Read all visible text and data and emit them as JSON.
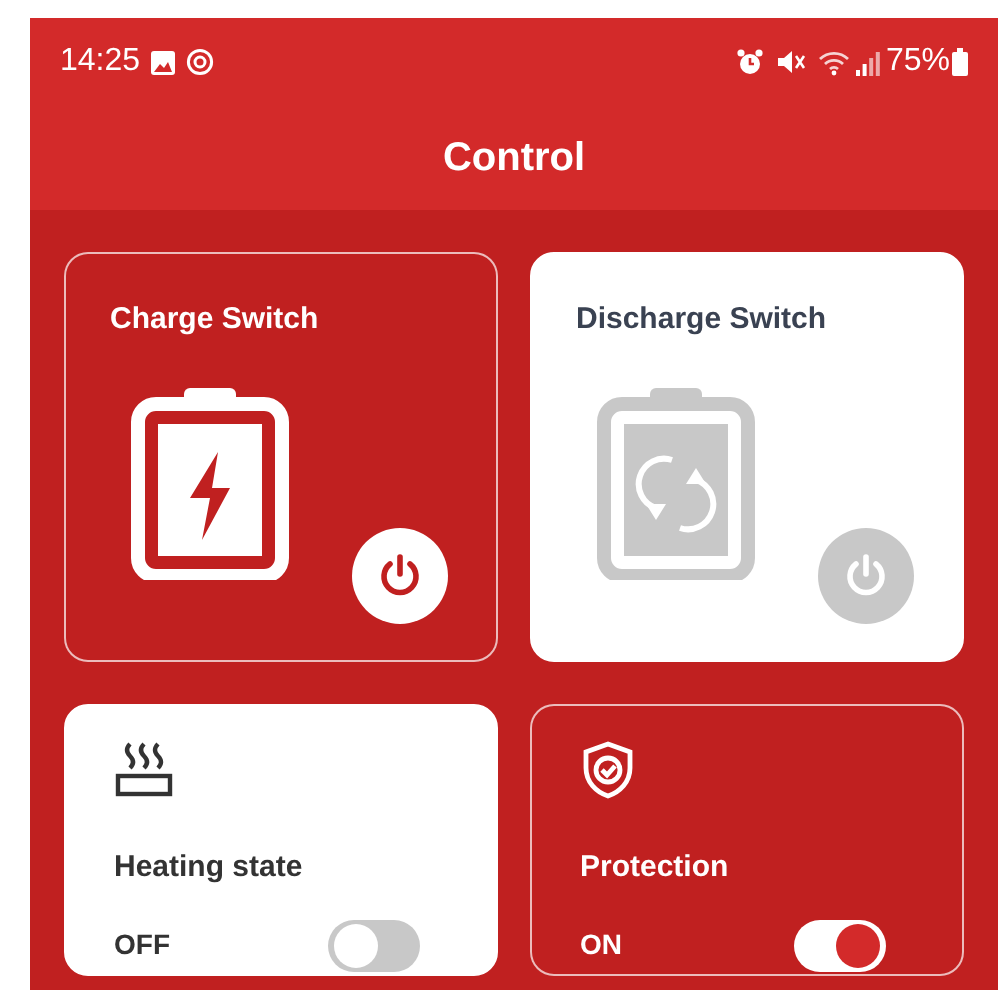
{
  "status_bar": {
    "time": "14:25",
    "battery": "75%"
  },
  "header": {
    "title": "Control"
  },
  "switches": [
    {
      "kind": "charge",
      "label": "Charge Switch",
      "on": true
    },
    {
      "kind": "discharge",
      "label": "Discharge Switch",
      "on": false
    }
  ],
  "toggles": [
    {
      "kind": "heating",
      "label": "Heating state",
      "state": "OFF",
      "on": false
    },
    {
      "kind": "protection",
      "label": "Protection",
      "state": "ON",
      "on": true
    }
  ]
}
